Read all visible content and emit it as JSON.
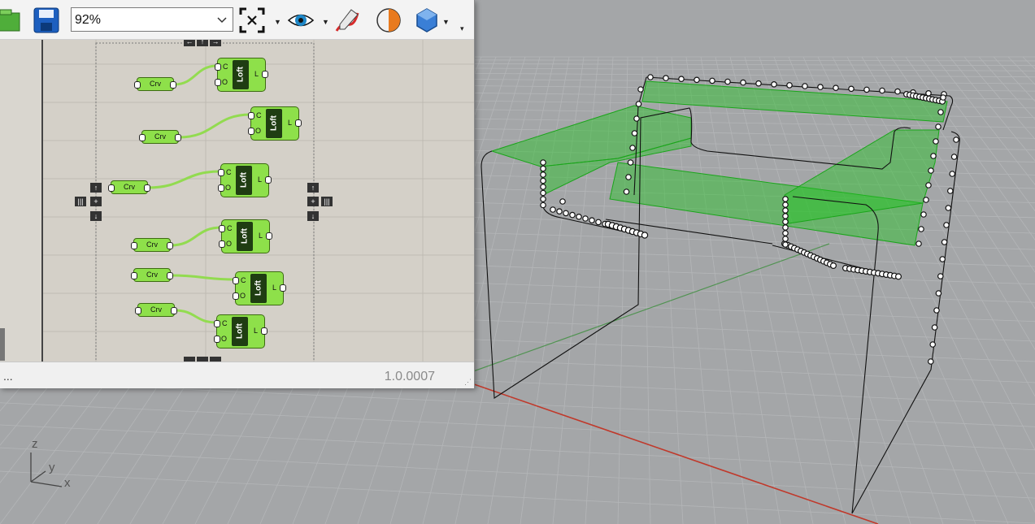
{
  "toolbar": {
    "zoom_value": "92%",
    "icons": [
      "open-file-icon",
      "save-file-icon",
      "zoom-extents-icon",
      "preview-eye-icon",
      "sketch-pen-icon",
      "shader-toggle-icon",
      "display-mode-icon"
    ]
  },
  "canvas": {
    "components": [
      {
        "input_label": "Crv",
        "loft": {
          "title": "Loft",
          "input_c": "C",
          "input_o": "O",
          "output": "L"
        }
      },
      {
        "input_label": "Crv",
        "loft": {
          "title": "Loft",
          "input_c": "C",
          "input_o": "O",
          "output": "L"
        }
      },
      {
        "input_label": "Crv",
        "loft": {
          "title": "Loft",
          "input_c": "C",
          "input_o": "O",
          "output": "L"
        }
      },
      {
        "input_label": "Crv",
        "loft": {
          "title": "Loft",
          "input_c": "C",
          "input_o": "O",
          "output": "L"
        }
      },
      {
        "input_label": "Crv",
        "loft": {
          "title": "Loft",
          "input_c": "C",
          "input_o": "O",
          "output": "L"
        }
      },
      {
        "input_label": "Crv",
        "loft": {
          "title": "Loft",
          "input_c": "C",
          "input_o": "O",
          "output": "L"
        }
      }
    ]
  },
  "statusbar": {
    "left_text": "...",
    "version": "1.0.0007"
  },
  "viewport": {
    "axis_labels": {
      "z": "z",
      "y": "y",
      "x": "x"
    }
  },
  "colors": {
    "component_green": "#8ee04a",
    "loft_surface": "#22c422",
    "grid_bg": "#a4a6a8",
    "x_axis": "#c0392b",
    "canvas_bg": "#d4d0c8"
  }
}
